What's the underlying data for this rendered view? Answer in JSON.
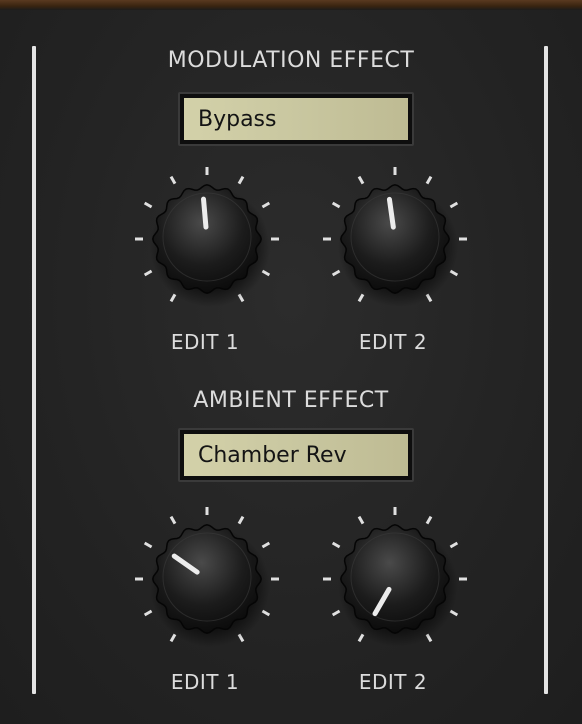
{
  "modulation": {
    "title": "MODULATION EFFECT",
    "display_value": "Bypass",
    "knobs": [
      {
        "label": "EDIT 1",
        "angle_deg": -5
      },
      {
        "label": "EDIT 2",
        "angle_deg": -8
      }
    ]
  },
  "ambient": {
    "title": "AMBIENT EFFECT",
    "display_value": "Chamber Rev",
    "knobs": [
      {
        "label": "EDIT 1",
        "angle_deg": -55
      },
      {
        "label": "EDIT 2",
        "angle_deg": -150
      }
    ]
  },
  "colors": {
    "background": "#262626",
    "rail": "#e4e4e4",
    "lcd": "#d3d1a9",
    "label": "#dcdcdc"
  }
}
